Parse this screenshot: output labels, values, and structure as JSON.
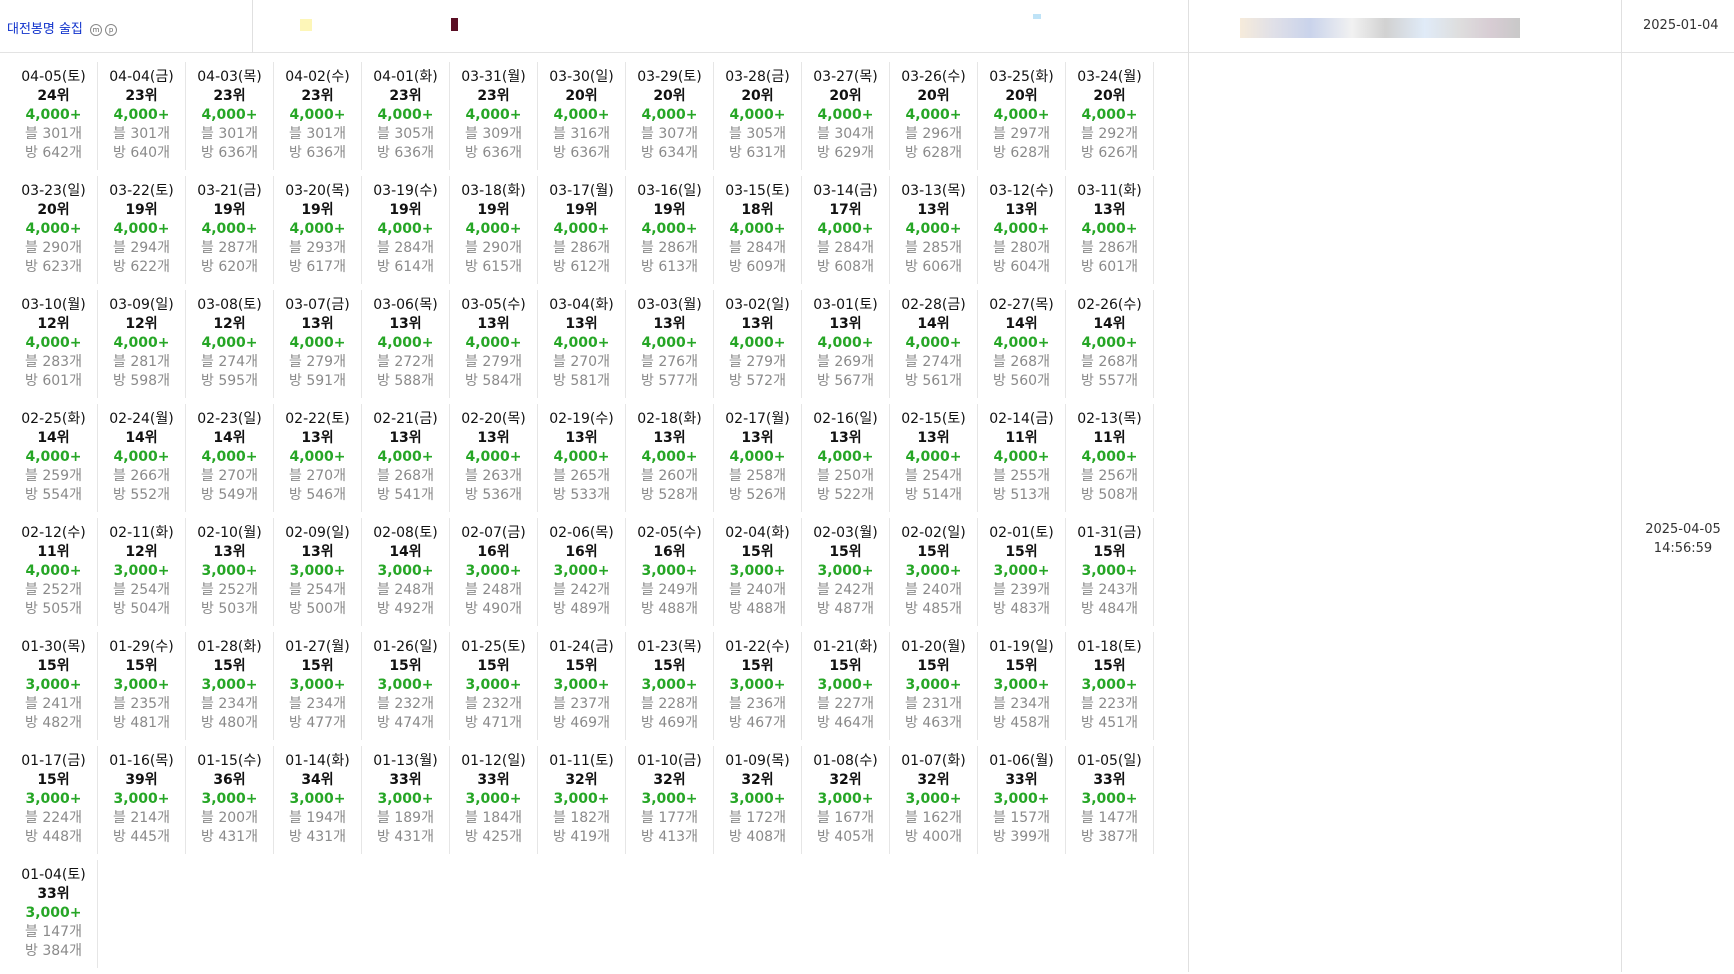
{
  "header": {
    "title": "대전봉명 술집",
    "badge_icons": [
      "m-icon",
      "p-icon"
    ],
    "date": "2025-01-04"
  },
  "side": {
    "date": "2025-04-05",
    "time": "14:56:59"
  },
  "colors": {
    "title": "#1133cc",
    "visitors": "#26a626",
    "counts": "#8a8a8a"
  },
  "labels": {
    "blog_prefix": "블 ",
    "room_prefix": "방 ",
    "count_suffix": "개",
    "rank_suffix": "위"
  },
  "entries": [
    {
      "date": "04-05(토)",
      "rank": "24위",
      "visitors": "4,000+",
      "blog": "블 301개",
      "room": "방 642개"
    },
    {
      "date": "04-04(금)",
      "rank": "23위",
      "visitors": "4,000+",
      "blog": "블 301개",
      "room": "방 640개"
    },
    {
      "date": "04-03(목)",
      "rank": "23위",
      "visitors": "4,000+",
      "blog": "블 301개",
      "room": "방 636개"
    },
    {
      "date": "04-02(수)",
      "rank": "23위",
      "visitors": "4,000+",
      "blog": "블 301개",
      "room": "방 636개"
    },
    {
      "date": "04-01(화)",
      "rank": "23위",
      "visitors": "4,000+",
      "blog": "블 305개",
      "room": "방 636개"
    },
    {
      "date": "03-31(월)",
      "rank": "23위",
      "visitors": "4,000+",
      "blog": "블 309개",
      "room": "방 636개"
    },
    {
      "date": "03-30(일)",
      "rank": "20위",
      "visitors": "4,000+",
      "blog": "블 316개",
      "room": "방 636개"
    },
    {
      "date": "03-29(토)",
      "rank": "20위",
      "visitors": "4,000+",
      "blog": "블 307개",
      "room": "방 634개"
    },
    {
      "date": "03-28(금)",
      "rank": "20위",
      "visitors": "4,000+",
      "blog": "블 305개",
      "room": "방 631개"
    },
    {
      "date": "03-27(목)",
      "rank": "20위",
      "visitors": "4,000+",
      "blog": "블 304개",
      "room": "방 629개"
    },
    {
      "date": "03-26(수)",
      "rank": "20위",
      "visitors": "4,000+",
      "blog": "블 296개",
      "room": "방 628개"
    },
    {
      "date": "03-25(화)",
      "rank": "20위",
      "visitors": "4,000+",
      "blog": "블 297개",
      "room": "방 628개"
    },
    {
      "date": "03-24(월)",
      "rank": "20위",
      "visitors": "4,000+",
      "blog": "블 292개",
      "room": "방 626개"
    },
    {
      "date": "03-23(일)",
      "rank": "20위",
      "visitors": "4,000+",
      "blog": "블 290개",
      "room": "방 623개"
    },
    {
      "date": "03-22(토)",
      "rank": "19위",
      "visitors": "4,000+",
      "blog": "블 294개",
      "room": "방 622개"
    },
    {
      "date": "03-21(금)",
      "rank": "19위",
      "visitors": "4,000+",
      "blog": "블 287개",
      "room": "방 620개"
    },
    {
      "date": "03-20(목)",
      "rank": "19위",
      "visitors": "4,000+",
      "blog": "블 293개",
      "room": "방 617개"
    },
    {
      "date": "03-19(수)",
      "rank": "19위",
      "visitors": "4,000+",
      "blog": "블 284개",
      "room": "방 614개"
    },
    {
      "date": "03-18(화)",
      "rank": "19위",
      "visitors": "4,000+",
      "blog": "블 290개",
      "room": "방 615개"
    },
    {
      "date": "03-17(월)",
      "rank": "19위",
      "visitors": "4,000+",
      "blog": "블 286개",
      "room": "방 612개"
    },
    {
      "date": "03-16(일)",
      "rank": "19위",
      "visitors": "4,000+",
      "blog": "블 286개",
      "room": "방 613개"
    },
    {
      "date": "03-15(토)",
      "rank": "18위",
      "visitors": "4,000+",
      "blog": "블 284개",
      "room": "방 609개"
    },
    {
      "date": "03-14(금)",
      "rank": "17위",
      "visitors": "4,000+",
      "blog": "블 284개",
      "room": "방 608개"
    },
    {
      "date": "03-13(목)",
      "rank": "13위",
      "visitors": "4,000+",
      "blog": "블 285개",
      "room": "방 606개"
    },
    {
      "date": "03-12(수)",
      "rank": "13위",
      "visitors": "4,000+",
      "blog": "블 280개",
      "room": "방 604개"
    },
    {
      "date": "03-11(화)",
      "rank": "13위",
      "visitors": "4,000+",
      "blog": "블 286개",
      "room": "방 601개"
    },
    {
      "date": "03-10(월)",
      "rank": "12위",
      "visitors": "4,000+",
      "blog": "블 283개",
      "room": "방 601개"
    },
    {
      "date": "03-09(일)",
      "rank": "12위",
      "visitors": "4,000+",
      "blog": "블 281개",
      "room": "방 598개"
    },
    {
      "date": "03-08(토)",
      "rank": "12위",
      "visitors": "4,000+",
      "blog": "블 274개",
      "room": "방 595개"
    },
    {
      "date": "03-07(금)",
      "rank": "13위",
      "visitors": "4,000+",
      "blog": "블 279개",
      "room": "방 591개"
    },
    {
      "date": "03-06(목)",
      "rank": "13위",
      "visitors": "4,000+",
      "blog": "블 272개",
      "room": "방 588개"
    },
    {
      "date": "03-05(수)",
      "rank": "13위",
      "visitors": "4,000+",
      "blog": "블 279개",
      "room": "방 584개"
    },
    {
      "date": "03-04(화)",
      "rank": "13위",
      "visitors": "4,000+",
      "blog": "블 270개",
      "room": "방 581개"
    },
    {
      "date": "03-03(월)",
      "rank": "13위",
      "visitors": "4,000+",
      "blog": "블 276개",
      "room": "방 577개"
    },
    {
      "date": "03-02(일)",
      "rank": "13위",
      "visitors": "4,000+",
      "blog": "블 279개",
      "room": "방 572개"
    },
    {
      "date": "03-01(토)",
      "rank": "13위",
      "visitors": "4,000+",
      "blog": "블 269개",
      "room": "방 567개"
    },
    {
      "date": "02-28(금)",
      "rank": "14위",
      "visitors": "4,000+",
      "blog": "블 274개",
      "room": "방 561개"
    },
    {
      "date": "02-27(목)",
      "rank": "14위",
      "visitors": "4,000+",
      "blog": "블 268개",
      "room": "방 560개"
    },
    {
      "date": "02-26(수)",
      "rank": "14위",
      "visitors": "4,000+",
      "blog": "블 268개",
      "room": "방 557개"
    },
    {
      "date": "02-25(화)",
      "rank": "14위",
      "visitors": "4,000+",
      "blog": "블 259개",
      "room": "방 554개"
    },
    {
      "date": "02-24(월)",
      "rank": "14위",
      "visitors": "4,000+",
      "blog": "블 266개",
      "room": "방 552개"
    },
    {
      "date": "02-23(일)",
      "rank": "14위",
      "visitors": "4,000+",
      "blog": "블 270개",
      "room": "방 549개"
    },
    {
      "date": "02-22(토)",
      "rank": "13위",
      "visitors": "4,000+",
      "blog": "블 270개",
      "room": "방 546개"
    },
    {
      "date": "02-21(금)",
      "rank": "13위",
      "visitors": "4,000+",
      "blog": "블 268개",
      "room": "방 541개"
    },
    {
      "date": "02-20(목)",
      "rank": "13위",
      "visitors": "4,000+",
      "blog": "블 263개",
      "room": "방 536개"
    },
    {
      "date": "02-19(수)",
      "rank": "13위",
      "visitors": "4,000+",
      "blog": "블 265개",
      "room": "방 533개"
    },
    {
      "date": "02-18(화)",
      "rank": "13위",
      "visitors": "4,000+",
      "blog": "블 260개",
      "room": "방 528개"
    },
    {
      "date": "02-17(월)",
      "rank": "13위",
      "visitors": "4,000+",
      "blog": "블 258개",
      "room": "방 526개"
    },
    {
      "date": "02-16(일)",
      "rank": "13위",
      "visitors": "4,000+",
      "blog": "블 250개",
      "room": "방 522개"
    },
    {
      "date": "02-15(토)",
      "rank": "13위",
      "visitors": "4,000+",
      "blog": "블 254개",
      "room": "방 514개"
    },
    {
      "date": "02-14(금)",
      "rank": "11위",
      "visitors": "4,000+",
      "blog": "블 255개",
      "room": "방 513개"
    },
    {
      "date": "02-13(목)",
      "rank": "11위",
      "visitors": "4,000+",
      "blog": "블 256개",
      "room": "방 508개"
    },
    {
      "date": "02-12(수)",
      "rank": "11위",
      "visitors": "4,000+",
      "blog": "블 252개",
      "room": "방 505개"
    },
    {
      "date": "02-11(화)",
      "rank": "12위",
      "visitors": "3,000+",
      "blog": "블 254개",
      "room": "방 504개"
    },
    {
      "date": "02-10(월)",
      "rank": "13위",
      "visitors": "3,000+",
      "blog": "블 252개",
      "room": "방 503개"
    },
    {
      "date": "02-09(일)",
      "rank": "13위",
      "visitors": "3,000+",
      "blog": "블 254개",
      "room": "방 500개"
    },
    {
      "date": "02-08(토)",
      "rank": "14위",
      "visitors": "3,000+",
      "blog": "블 248개",
      "room": "방 492개"
    },
    {
      "date": "02-07(금)",
      "rank": "16위",
      "visitors": "3,000+",
      "blog": "블 248개",
      "room": "방 490개"
    },
    {
      "date": "02-06(목)",
      "rank": "16위",
      "visitors": "3,000+",
      "blog": "블 242개",
      "room": "방 489개"
    },
    {
      "date": "02-05(수)",
      "rank": "16위",
      "visitors": "3,000+",
      "blog": "블 249개",
      "room": "방 488개"
    },
    {
      "date": "02-04(화)",
      "rank": "15위",
      "visitors": "3,000+",
      "blog": "블 240개",
      "room": "방 488개"
    },
    {
      "date": "02-03(월)",
      "rank": "15위",
      "visitors": "3,000+",
      "blog": "블 242개",
      "room": "방 487개"
    },
    {
      "date": "02-02(일)",
      "rank": "15위",
      "visitors": "3,000+",
      "blog": "블 240개",
      "room": "방 485개"
    },
    {
      "date": "02-01(토)",
      "rank": "15위",
      "visitors": "3,000+",
      "blog": "블 239개",
      "room": "방 483개"
    },
    {
      "date": "01-31(금)",
      "rank": "15위",
      "visitors": "3,000+",
      "blog": "블 243개",
      "room": "방 484개"
    },
    {
      "date": "01-30(목)",
      "rank": "15위",
      "visitors": "3,000+",
      "blog": "블 241개",
      "room": "방 482개"
    },
    {
      "date": "01-29(수)",
      "rank": "15위",
      "visitors": "3,000+",
      "blog": "블 235개",
      "room": "방 481개"
    },
    {
      "date": "01-28(화)",
      "rank": "15위",
      "visitors": "3,000+",
      "blog": "블 234개",
      "room": "방 480개"
    },
    {
      "date": "01-27(월)",
      "rank": "15위",
      "visitors": "3,000+",
      "blog": "블 234개",
      "room": "방 477개"
    },
    {
      "date": "01-26(일)",
      "rank": "15위",
      "visitors": "3,000+",
      "blog": "블 232개",
      "room": "방 474개"
    },
    {
      "date": "01-25(토)",
      "rank": "15위",
      "visitors": "3,000+",
      "blog": "블 232개",
      "room": "방 471개"
    },
    {
      "date": "01-24(금)",
      "rank": "15위",
      "visitors": "3,000+",
      "blog": "블 237개",
      "room": "방 469개"
    },
    {
      "date": "01-23(목)",
      "rank": "15위",
      "visitors": "3,000+",
      "blog": "블 228개",
      "room": "방 469개"
    },
    {
      "date": "01-22(수)",
      "rank": "15위",
      "visitors": "3,000+",
      "blog": "블 236개",
      "room": "방 467개"
    },
    {
      "date": "01-21(화)",
      "rank": "15위",
      "visitors": "3,000+",
      "blog": "블 227개",
      "room": "방 464개"
    },
    {
      "date": "01-20(월)",
      "rank": "15위",
      "visitors": "3,000+",
      "blog": "블 231개",
      "room": "방 463개"
    },
    {
      "date": "01-19(일)",
      "rank": "15위",
      "visitors": "3,000+",
      "blog": "블 234개",
      "room": "방 458개"
    },
    {
      "date": "01-18(토)",
      "rank": "15위",
      "visitors": "3,000+",
      "blog": "블 223개",
      "room": "방 451개"
    },
    {
      "date": "01-17(금)",
      "rank": "15위",
      "visitors": "3,000+",
      "blog": "블 224개",
      "room": "방 448개"
    },
    {
      "date": "01-16(목)",
      "rank": "39위",
      "visitors": "3,000+",
      "blog": "블 214개",
      "room": "방 445개"
    },
    {
      "date": "01-15(수)",
      "rank": "36위",
      "visitors": "3,000+",
      "blog": "블 200개",
      "room": "방 431개"
    },
    {
      "date": "01-14(화)",
      "rank": "34위",
      "visitors": "3,000+",
      "blog": "블 194개",
      "room": "방 431개"
    },
    {
      "date": "01-13(월)",
      "rank": "33위",
      "visitors": "3,000+",
      "blog": "블 189개",
      "room": "방 431개"
    },
    {
      "date": "01-12(일)",
      "rank": "33위",
      "visitors": "3,000+",
      "blog": "블 184개",
      "room": "방 425개"
    },
    {
      "date": "01-11(토)",
      "rank": "32위",
      "visitors": "3,000+",
      "blog": "블 182개",
      "room": "방 419개"
    },
    {
      "date": "01-10(금)",
      "rank": "32위",
      "visitors": "3,000+",
      "blog": "블 177개",
      "room": "방 413개"
    },
    {
      "date": "01-09(목)",
      "rank": "32위",
      "visitors": "3,000+",
      "blog": "블 172개",
      "room": "방 408개"
    },
    {
      "date": "01-08(수)",
      "rank": "32위",
      "visitors": "3,000+",
      "blog": "블 167개",
      "room": "방 405개"
    },
    {
      "date": "01-07(화)",
      "rank": "32위",
      "visitors": "3,000+",
      "blog": "블 162개",
      "room": "방 400개"
    },
    {
      "date": "01-06(월)",
      "rank": "33위",
      "visitors": "3,000+",
      "blog": "블 157개",
      "room": "방 399개"
    },
    {
      "date": "01-05(일)",
      "rank": "33위",
      "visitors": "3,000+",
      "blog": "블 147개",
      "room": "방 387개"
    },
    {
      "date": "01-04(토)",
      "rank": "33위",
      "visitors": "3,000+",
      "blog": "블 147개",
      "room": "방 384개"
    }
  ]
}
